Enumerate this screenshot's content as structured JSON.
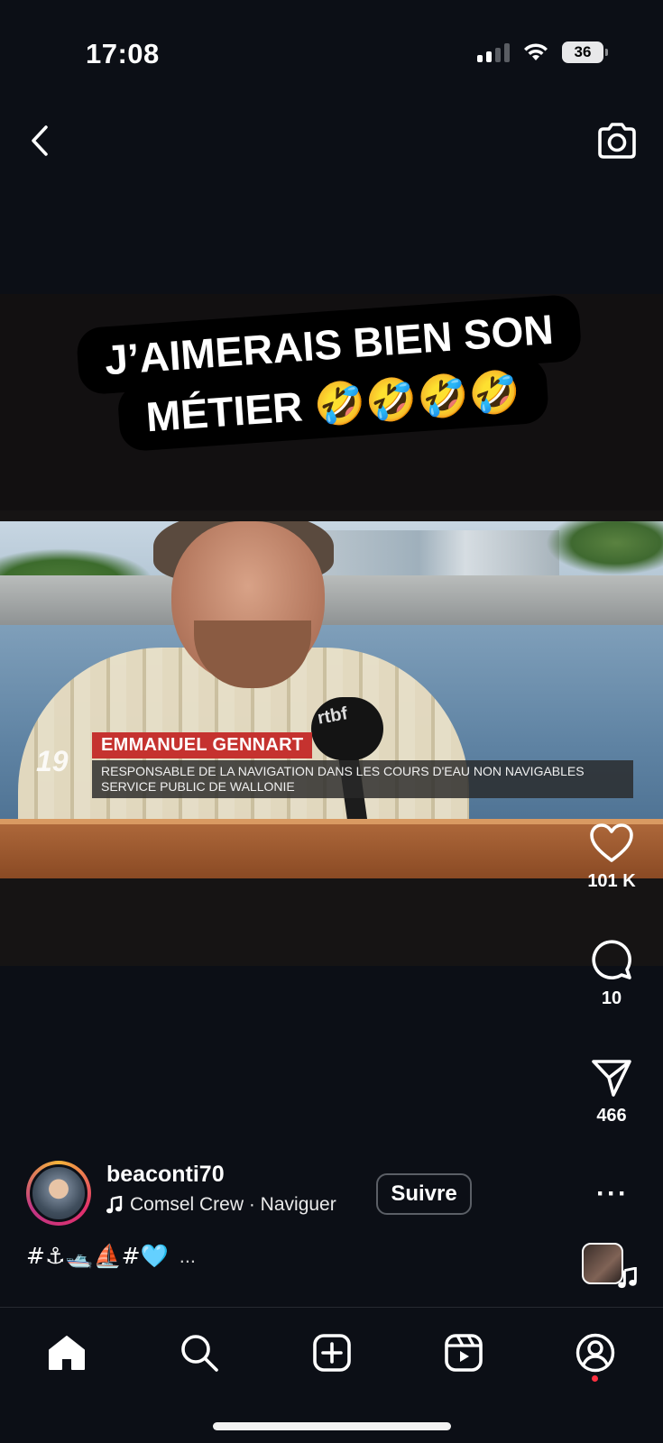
{
  "status_bar": {
    "time": "17:08",
    "battery": "36"
  },
  "icons": {
    "back": "chevron-left-icon",
    "camera": "camera-icon",
    "like": "heart-icon",
    "comment": "comment-icon",
    "share": "send-icon",
    "more": "more-icon",
    "music": "music-note-icon",
    "home": "home-icon",
    "search": "search-icon",
    "create": "create-icon",
    "reels": "reels-icon",
    "profile": "profile-icon"
  },
  "reel": {
    "caption_line1": "J’AIMERAIS BIEN SON",
    "caption_line2": "MÉTIER 🤣🤣🤣🤣",
    "tv_name": "EMMANUEL GENNART",
    "tv_role_line1": "RESPONSABLE DE LA NAVIGATION DANS LES COURS D'EAU NON NAVIGABLES",
    "tv_role_line2": "SERVICE PUBLIC DE WALLONIE",
    "tv_channel": "19",
    "tv_mic": "rtbf"
  },
  "actions": {
    "likes": "101 K",
    "comments": "10",
    "shares": "466"
  },
  "post": {
    "username": "beaconti70",
    "audio": "Comsel Crew · Naviguer",
    "follow_label": "Suivre",
    "more_label": "···",
    "tags": "#⚓🛥️⛵#🩵",
    "tags_more": "..."
  },
  "colors": {
    "background": "#0c0f16",
    "accent_red": "#ff3040",
    "lower_third_red": "#c5322f"
  }
}
